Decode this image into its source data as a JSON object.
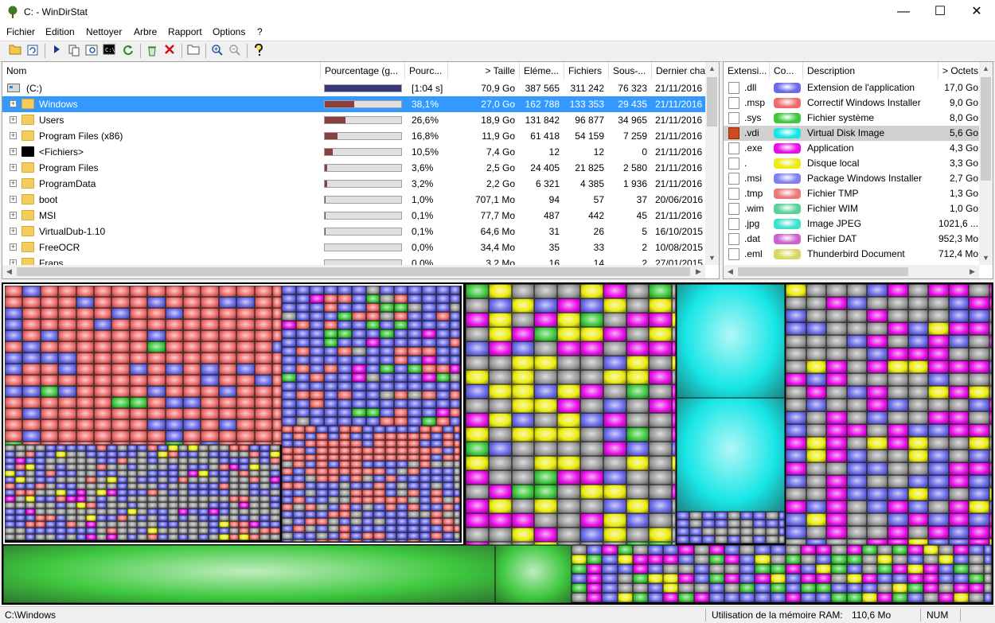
{
  "window": {
    "title": "C: - WinDirStat",
    "minimize": "—",
    "maximize": "☐",
    "close": "✕"
  },
  "menu": [
    "Fichier",
    "Edition",
    "Nettoyer",
    "Arbre",
    "Rapport",
    "Options",
    "?"
  ],
  "toolbar": {
    "icons": [
      "open-icon",
      "refresh-icon",
      "play-icon",
      "copy-icon",
      "explorer-icon",
      "command-prompt-icon",
      "refresh-selected-icon",
      "recycle-icon",
      "delete-icon",
      "new-folder-icon",
      "zoom-in-icon",
      "zoom-out-icon",
      "help-icon"
    ]
  },
  "tree": {
    "columns": [
      "Nom",
      "Pourcentage (g...",
      "Pourc...",
      "> Taille",
      "Eléme...",
      "Fichiers",
      "Sous-...",
      "Dernier cha"
    ],
    "root": {
      "name": "(C:)",
      "percent": "[1:04 s]",
      "size": "70,9 Go",
      "items": "387 565",
      "files": "311 242",
      "subdirs": "76 323",
      "date": "21/11/2016",
      "fill": 1.0
    },
    "rows": [
      {
        "name": "Windows",
        "percent": "38,1%",
        "size": "27,0 Go",
        "items": "162 788",
        "files": "133 353",
        "subdirs": "29 435",
        "date": "21/11/2016",
        "fill": 0.381,
        "selected": true,
        "icon": "folder"
      },
      {
        "name": "Users",
        "percent": "26,6%",
        "size": "18,9 Go",
        "items": "131 842",
        "files": "96 877",
        "subdirs": "34 965",
        "date": "21/11/2016",
        "fill": 0.266,
        "selected": false,
        "icon": "folder"
      },
      {
        "name": "Program Files (x86)",
        "percent": "16,8%",
        "size": "11,9 Go",
        "items": "61 418",
        "files": "54 159",
        "subdirs": "7 259",
        "date": "21/11/2016",
        "fill": 0.168,
        "selected": false,
        "icon": "folder"
      },
      {
        "name": "<Fichiers>",
        "percent": "10,5%",
        "size": "7,4 Go",
        "items": "12",
        "files": "12",
        "subdirs": "0",
        "date": "21/11/2016",
        "fill": 0.105,
        "selected": false,
        "icon": "files"
      },
      {
        "name": "Program Files",
        "percent": "3,6%",
        "size": "2,5 Go",
        "items": "24 405",
        "files": "21 825",
        "subdirs": "2 580",
        "date": "21/11/2016",
        "fill": 0.036,
        "selected": false,
        "icon": "folder"
      },
      {
        "name": "ProgramData",
        "percent": "3,2%",
        "size": "2,2 Go",
        "items": "6 321",
        "files": "4 385",
        "subdirs": "1 936",
        "date": "21/11/2016",
        "fill": 0.032,
        "selected": false,
        "icon": "folder"
      },
      {
        "name": "boot",
        "percent": "1,0%",
        "size": "707,1 Mo",
        "items": "94",
        "files": "57",
        "subdirs": "37",
        "date": "20/06/2016",
        "fill": 0.01,
        "selected": false,
        "icon": "folder"
      },
      {
        "name": "MSI",
        "percent": "0,1%",
        "size": "77,7 Mo",
        "items": "487",
        "files": "442",
        "subdirs": "45",
        "date": "21/11/2016",
        "fill": 0.001,
        "selected": false,
        "icon": "folder"
      },
      {
        "name": "VirtualDub-1.10",
        "percent": "0,1%",
        "size": "64,6 Mo",
        "items": "31",
        "files": "26",
        "subdirs": "5",
        "date": "16/10/2015",
        "fill": 0.001,
        "selected": false,
        "icon": "folder"
      },
      {
        "name": "FreeOCR",
        "percent": "0,0%",
        "size": "34,4 Mo",
        "items": "35",
        "files": "33",
        "subdirs": "2",
        "date": "10/08/2015",
        "fill": 0.0,
        "selected": false,
        "icon": "folder"
      },
      {
        "name": "Fraps",
        "percent": "0,0%",
        "size": "3,2 Mo",
        "items": "16",
        "files": "14",
        "subdirs": "2",
        "date": "27/01/2015",
        "fill": 0.0,
        "selected": false,
        "icon": "folder"
      }
    ]
  },
  "extensions": {
    "columns": [
      "Extensi...",
      "Co...",
      "Description",
      "> Octets"
    ],
    "rows": [
      {
        "ext": ".dll",
        "color": "#6a6ae8",
        "desc": "Extension de l'application",
        "size": "17,0 Go",
        "selected": false
      },
      {
        "ext": ".msp",
        "color": "#ef6b6b",
        "desc": "Correctif Windows Installer",
        "size": "9,0 Go",
        "selected": false
      },
      {
        "ext": ".sys",
        "color": "#3ec83e",
        "desc": "Fichier système",
        "size": "8,0 Go",
        "selected": false
      },
      {
        "ext": ".vdi",
        "color": "#18e6e6",
        "desc": "Virtual Disk Image",
        "size": "5,6 Go",
        "selected": true
      },
      {
        "ext": ".exe",
        "color": "#e80ee8",
        "desc": "Application",
        "size": "4,3 Go",
        "selected": false
      },
      {
        "ext": ".",
        "color": "#ecec10",
        "desc": "Disque local",
        "size": "3,3 Go",
        "selected": false
      },
      {
        "ext": ".msi",
        "color": "#8080ee",
        "desc": "Package Windows Installer",
        "size": "2,7 Go",
        "selected": false
      },
      {
        "ext": ".tmp",
        "color": "#ec7878",
        "desc": "Fichier TMP",
        "size": "1,3 Go",
        "selected": false
      },
      {
        "ext": ".wim",
        "color": "#5cd09a",
        "desc": "Fichier WIM",
        "size": "1,0 Go",
        "selected": false
      },
      {
        "ext": ".jpg",
        "color": "#40e0d0",
        "desc": "Image JPEG",
        "size": "1021,6 ...",
        "selected": false
      },
      {
        "ext": ".dat",
        "color": "#d060d0",
        "desc": "Fichier DAT",
        "size": "952,3 Mo",
        "selected": false
      },
      {
        "ext": ".eml",
        "color": "#d8d860",
        "desc": "Thunderbird Document",
        "size": "712,4 Mo",
        "selected": false
      }
    ]
  },
  "status": {
    "path": "C:\\Windows",
    "ram_label": "Utilisation de la mémoire RAM:",
    "ram_value": "110,6 Mo",
    "num": "NUM"
  }
}
